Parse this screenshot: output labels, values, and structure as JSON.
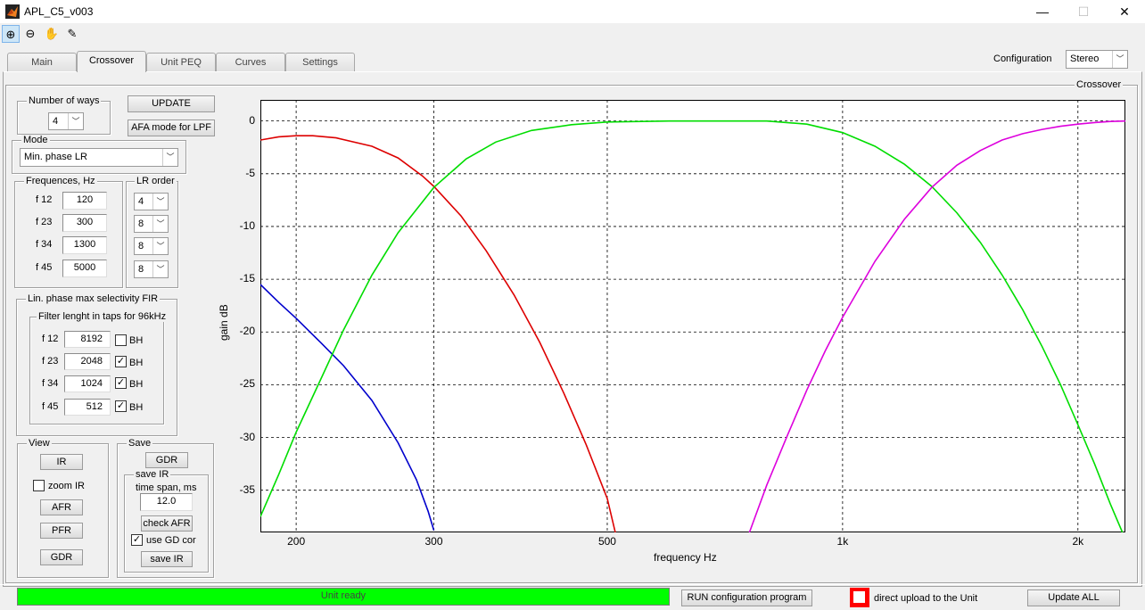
{
  "window": {
    "title": "APL_C5_v003",
    "minimize": "—",
    "maximize": "☐",
    "close": "✕"
  },
  "toolbar": [
    {
      "name": "zoom-in-icon",
      "glyph": "⊕"
    },
    {
      "name": "zoom-out-icon",
      "glyph": "⊖"
    },
    {
      "name": "pan-hand-icon",
      "glyph": "✋"
    },
    {
      "name": "data-cursor-icon",
      "glyph": "✎"
    }
  ],
  "tabs": [
    "Main",
    "Crossover",
    "Unit PEQ",
    "Curves",
    "Settings"
  ],
  "configuration": {
    "label": "Configuration",
    "value": "Stereo"
  },
  "panel_title": "Crossover",
  "ways": {
    "label": "Number of ways",
    "value": "4"
  },
  "buttons": {
    "update": "UPDATE",
    "afa": "AFA mode for LPF"
  },
  "mode": {
    "label": "Mode",
    "value": "Min. phase LR"
  },
  "frequencies": {
    "label": "Frequences, Hz",
    "rows": [
      {
        "name": "f 12",
        "value": "120"
      },
      {
        "name": "f 23",
        "value": "300"
      },
      {
        "name": "f 34",
        "value": "1300"
      },
      {
        "name": "f 45",
        "value": "5000"
      }
    ]
  },
  "lr_order": {
    "label": "LR order",
    "values": [
      "4",
      "8",
      "8",
      "8"
    ]
  },
  "fir": {
    "label": "Lin. phase max selectivity FIR",
    "sublabel": "Filter lenght in taps for 96kHz",
    "bh_label": "BH",
    "rows": [
      {
        "name": "f 12",
        "value": "8192",
        "bh": false
      },
      {
        "name": "f 23",
        "value": "2048",
        "bh": true
      },
      {
        "name": "f 34",
        "value": "1024",
        "bh": true
      },
      {
        "name": "f 45",
        "value": "512",
        "bh": true
      }
    ]
  },
  "view": {
    "label": "View",
    "ir": "IR",
    "zoom_ir": "zoom IR",
    "zoom_checked": false,
    "afr": "AFR",
    "pfr": "PFR",
    "gdr": "GDR"
  },
  "save": {
    "label": "Save",
    "gdr": "GDR",
    "save_ir_label": "save IR",
    "time_span_label": "time span, ms",
    "time_span": "12.0",
    "check_afr": "check AFR",
    "use_gd_cor": "use GD cor",
    "use_gd_checked": true,
    "save_ir": "save IR"
  },
  "bottom": {
    "status": "Unit ready",
    "run": "RUN configuration program",
    "direct_upload": "direct upload to the Unit",
    "update_all": "Update ALL",
    "direct_color": "#ff0000",
    "status_color": "#00ff00"
  },
  "chart_data": {
    "type": "line",
    "title": "",
    "xlabel": "frequency   Hz",
    "ylabel": "gain dB",
    "xscale": "log",
    "xlim": [
      180,
      2300
    ],
    "ylim": [
      -39,
      2
    ],
    "xticks": [
      200,
      300,
      500,
      1000,
      2000
    ],
    "xtick_labels": [
      "200",
      "300",
      "500",
      "1k",
      "2k"
    ],
    "yticks": [
      0,
      -5,
      -10,
      -15,
      -20,
      -25,
      -30,
      -35
    ],
    "ytick_labels": [
      "0",
      "-5",
      "-10",
      "-15",
      "-20",
      "-25",
      "-30",
      "-35"
    ],
    "grid": true,
    "series": [
      {
        "color": "#0000cc",
        "x": [
          180,
          190,
          200,
          215,
          230,
          250,
          270,
          285,
          295,
          300
        ],
        "y": [
          -15.5,
          -17.2,
          -18.7,
          -21,
          -23.2,
          -26.5,
          -30.5,
          -34,
          -37,
          -38.8
        ]
      },
      {
        "color": "#dd0000",
        "x": [
          180,
          190,
          200,
          210,
          225,
          250,
          270,
          290,
          300,
          325,
          350,
          380,
          410,
          440,
          470,
          500,
          512
        ],
        "y": [
          -1.8,
          -1.5,
          -1.4,
          -1.4,
          -1.6,
          -2.4,
          -3.5,
          -5.2,
          -6.2,
          -9,
          -12.3,
          -16.5,
          -21,
          -25.8,
          -30.7,
          -35.8,
          -39
        ]
      },
      {
        "color": "#00dd00",
        "x": [
          180,
          190,
          200,
          215,
          230,
          250,
          270,
          300,
          330,
          360,
          400,
          450,
          500,
          600,
          700,
          800,
          900,
          1000,
          1100,
          1200,
          1300,
          1400,
          1500,
          1600,
          1700,
          1800,
          1900,
          2000,
          2100,
          2200,
          2280
        ],
        "y": [
          -37.5,
          -33.5,
          -29.5,
          -24.5,
          -19.8,
          -14.6,
          -10.6,
          -6.3,
          -3.6,
          -2.0,
          -0.9,
          -0.35,
          -0.1,
          0,
          0,
          0,
          -0.3,
          -1.1,
          -2.4,
          -4.1,
          -6.2,
          -8.7,
          -11.5,
          -14.6,
          -17.9,
          -21.4,
          -25,
          -28.8,
          -32.5,
          -36.3,
          -39
        ]
      },
      {
        "color": "#dd00dd",
        "x": [
          760,
          800,
          850,
          900,
          950,
          1000,
          1100,
          1200,
          1300,
          1400,
          1500,
          1600,
          1700,
          1800,
          1900,
          2000,
          2100,
          2200,
          2300
        ],
        "y": [
          -39,
          -34.5,
          -29.8,
          -25.5,
          -21.8,
          -18.6,
          -13.3,
          -9.3,
          -6.3,
          -4.2,
          -2.8,
          -1.8,
          -1.2,
          -0.8,
          -0.5,
          -0.3,
          -0.15,
          -0.05,
          0
        ]
      }
    ]
  }
}
